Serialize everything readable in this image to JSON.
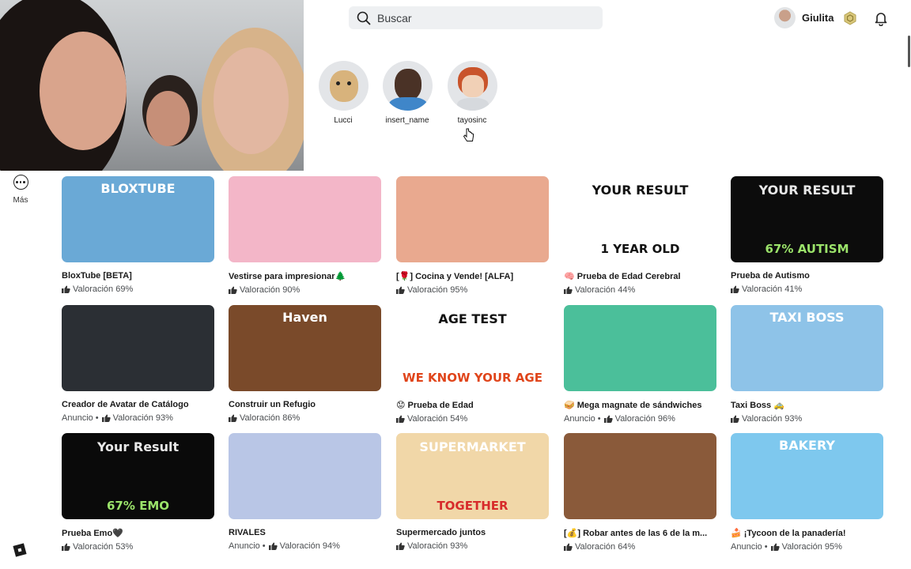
{
  "search": {
    "label": "Buscar"
  },
  "user": {
    "name": "Giulita"
  },
  "friends": [
    {
      "name": "Lucci"
    },
    {
      "name": "insert_name"
    },
    {
      "name": "tayosinc"
    }
  ],
  "sidebar": {
    "more_label": "Más"
  },
  "games": [
    {
      "title": "BloxTube [BETA]",
      "ad": "",
      "rating": "Valoración 69%",
      "thumb_text": "BLOXTUBE",
      "color": "#6aa9d6"
    },
    {
      "title": "Vestirse para impresionar🌲",
      "ad": "",
      "rating": "Valoración 90%",
      "thumb_text": "",
      "color": "#f3b6c8"
    },
    {
      "title": "[🌹] Cocina y Vende! [ALFA]",
      "ad": "",
      "rating": "Valoración 95%",
      "thumb_text": "",
      "color": "#e9a98f"
    },
    {
      "title": "🧠 Prueba de Edad Cerebral",
      "ad": "",
      "rating": "Valoración 44%",
      "thumb_text": "YOUR RESULT",
      "thumb_text2": "1 YEAR OLD",
      "color": "#ffffff"
    },
    {
      "title": "Prueba de Autismo",
      "ad": "",
      "rating": "Valoración 41%",
      "thumb_text": "YOUR RESULT",
      "thumb_text2": "67% AUTISM",
      "color": "#0c0c0c"
    },
    {
      "title": "Creador de Avatar de Catálogo",
      "ad": "Anuncio •",
      "rating": "Valoración 93%",
      "thumb_text": "",
      "color": "#2b2f34"
    },
    {
      "title": "Construir un Refugio",
      "ad": "",
      "rating": "Valoración 86%",
      "thumb_text": "Haven",
      "color": "#7a4a2a"
    },
    {
      "title": "😟 Prueba de Edad",
      "ad": "",
      "rating": "Valoración 54%",
      "thumb_text": "AGE TEST",
      "thumb_text2": "WE KNOW YOUR AGE",
      "color": "#ffffff"
    },
    {
      "title": "🥪 Mega magnate de sándwiches",
      "ad": "Anuncio •",
      "rating": "Valoración 96%",
      "thumb_text": "",
      "color": "#4bbf9a"
    },
    {
      "title": "Taxi Boss 🚕",
      "ad": "",
      "rating": "Valoración 93%",
      "thumb_text": "TAXI BOSS",
      "color": "#8ec3e8"
    },
    {
      "title": "Prueba Emo🖤",
      "ad": "",
      "rating": "Valoración 53%",
      "thumb_text": "Your Result",
      "thumb_text2": "67% EMO",
      "color": "#0a0a0a"
    },
    {
      "title": "RIVALES",
      "ad": "Anuncio •",
      "rating": "Valoración 94%",
      "thumb_text": "",
      "color": "#b9c6e6"
    },
    {
      "title": "Supermercado juntos",
      "ad": "",
      "rating": "Valoración 93%",
      "thumb_text": "SUPERMARKET",
      "thumb_text2": "TOGETHER",
      "color": "#f1d7a8"
    },
    {
      "title": "[💰] Robar antes de las 6 de la m...",
      "ad": "",
      "rating": "Valoración 64%",
      "thumb_text": "",
      "color": "#8a5a3a"
    },
    {
      "title": "🍰 ¡Tycoon de la panadería!",
      "ad": "Anuncio •",
      "rating": "Valoración 95%",
      "thumb_text": "BAKERY",
      "color": "#7ec8ee"
    }
  ],
  "icons": [
    "search-icon",
    "robux-icon",
    "bell-icon",
    "more-icon",
    "roblox-logo-icon",
    "thumbs-up-icon",
    "cursor-icon"
  ]
}
